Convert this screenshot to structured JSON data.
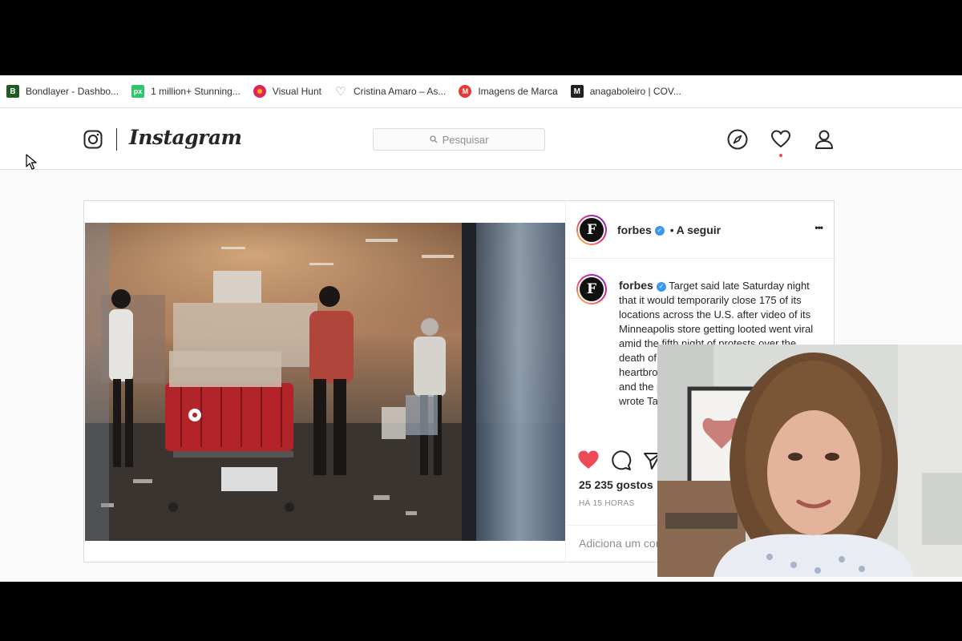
{
  "bookmarks": [
    {
      "label": "Bondlayer - Dashbo...",
      "icon": "bondlayer-icon",
      "color": "#1b5e20",
      "glyph": "B"
    },
    {
      "label": "1 million+ Stunning...",
      "icon": "pixabay-icon",
      "color": "#2ec66d",
      "glyph": "px"
    },
    {
      "label": "Visual Hunt",
      "icon": "visualhunt-icon",
      "color": "#e0245e",
      "glyph": ""
    },
    {
      "label": "Cristina Amaro – As...",
      "icon": "heart-outline-icon",
      "color": "#888888",
      "glyph": "♡"
    },
    {
      "label": "Imagens de Marca",
      "icon": "imagens-de-marca-icon",
      "color": "#e53935",
      "glyph": "M"
    },
    {
      "label": "anagaboleiro | COV...",
      "icon": "medium-icon",
      "color": "#222222",
      "glyph": "M"
    }
  ],
  "header": {
    "wordmark": "Instagram",
    "search_placeholder": "Pesquisar"
  },
  "post": {
    "username": "forbes",
    "follow_state": "A seguir",
    "separator": "•",
    "more": "•••",
    "avatar_letter": "F",
    "caption_user": "forbes",
    "caption_text": "Target said late Saturday night that it would temporarily close 175 of its locations across the U.S. after video of its Minneapolis store getting looted went viral amid the fifth night of protests over the death of George Floyd. \"We are heartbroken by the death of George Floyd and the pain our community is feeling,\" wrote Target.",
    "likes": "25 235 gostos",
    "time": "HÁ 15 HORAS",
    "comment_placeholder": "Adiciona um comentário..."
  },
  "colors": {
    "liked": "#ed4956",
    "verified": "#3897f0",
    "border": "#dbdbdb"
  }
}
